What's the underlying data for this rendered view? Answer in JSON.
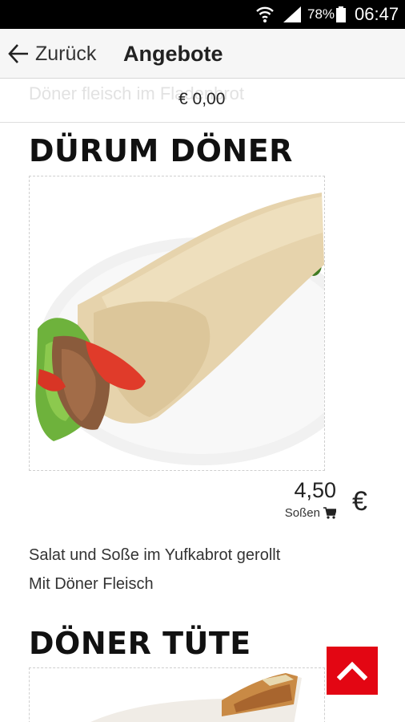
{
  "status": {
    "battery": "78%",
    "time": "06:47",
    "icons": [
      "wifi-icon",
      "signal-icon",
      "battery-icon"
    ]
  },
  "appbar": {
    "back_label": "Zurück",
    "title": "Angebote"
  },
  "previous_item": {
    "faded_name": "Döner fleisch im Fladenbrot",
    "price": "€ 0,00"
  },
  "products": [
    {
      "name": "DÜRUM DÖNER",
      "price": "4,50",
      "sauce_label": "Soßen",
      "currency": "€",
      "description": [
        "Salat und Soße im Yufkabrot gerollt",
        "Mit Döner Fleisch"
      ]
    },
    {
      "name": "DÖNER TÜTE"
    }
  ],
  "colors": {
    "accent": "#e30613",
    "statusbar": "#000000",
    "appbar": "#f6f6f6"
  }
}
